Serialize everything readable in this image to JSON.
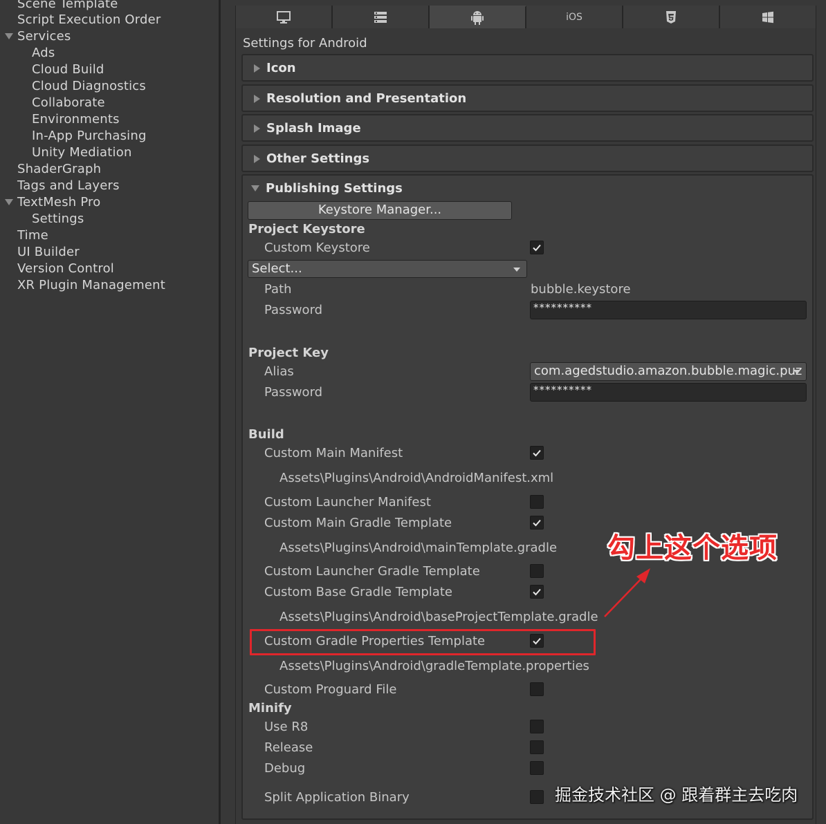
{
  "sidebar": {
    "items": [
      {
        "label": "Scene Template",
        "level": 1
      },
      {
        "label": "Script Execution Order",
        "level": 1
      },
      {
        "label": "Services",
        "level": 1,
        "expanded": true
      },
      {
        "label": "Ads",
        "level": 2
      },
      {
        "label": "Cloud Build",
        "level": 2
      },
      {
        "label": "Cloud Diagnostics",
        "level": 2
      },
      {
        "label": "Collaborate",
        "level": 2
      },
      {
        "label": "Environments",
        "level": 2
      },
      {
        "label": "In-App Purchasing",
        "level": 2
      },
      {
        "label": "Unity Mediation",
        "level": 2
      },
      {
        "label": "ShaderGraph",
        "level": 1
      },
      {
        "label": "Tags and Layers",
        "level": 1
      },
      {
        "label": "TextMesh Pro",
        "level": 1,
        "expanded": true
      },
      {
        "label": "Settings",
        "level": 2
      },
      {
        "label": "Time",
        "level": 1
      },
      {
        "label": "UI Builder",
        "level": 1
      },
      {
        "label": "Version Control",
        "level": 1
      },
      {
        "label": "XR Plugin Management",
        "level": 1
      }
    ]
  },
  "platform_tabs": [
    {
      "name": "standalone",
      "icon": "monitor-icon",
      "active": false
    },
    {
      "name": "server",
      "icon": "server-icon",
      "active": false
    },
    {
      "name": "android",
      "icon": "android-icon",
      "active": true
    },
    {
      "name": "ios",
      "label": "iOS",
      "active": false
    },
    {
      "name": "webgl",
      "icon": "html5-icon",
      "active": false
    },
    {
      "name": "windows",
      "icon": "windows-icon",
      "active": false
    }
  ],
  "settings_title": "Settings for Android",
  "foldouts": [
    {
      "label": "Icon"
    },
    {
      "label": "Resolution and Presentation"
    },
    {
      "label": "Splash Image"
    },
    {
      "label": "Other Settings"
    }
  ],
  "publishing": {
    "title": "Publishing Settings",
    "keystore_manager_button": "Keystore Manager...",
    "project_keystore": {
      "header": "Project Keystore",
      "custom_keystore_label": "Custom Keystore",
      "custom_keystore_checked": true,
      "select_value": "Select...",
      "path_label": "Path",
      "path_value": "bubble.keystore",
      "password_label": "Password",
      "password_value": "**********"
    },
    "project_key": {
      "header": "Project Key",
      "alias_label": "Alias",
      "alias_value": "com.agedstudio.amazon.bubble.magic.puz",
      "password_label": "Password",
      "password_value": "**********"
    },
    "build": {
      "header": "Build",
      "custom_main_manifest": {
        "label": "Custom Main Manifest",
        "checked": true,
        "path": "Assets\\Plugins\\Android\\AndroidManifest.xml"
      },
      "custom_launcher_manifest": {
        "label": "Custom Launcher Manifest",
        "checked": false
      },
      "custom_main_gradle_template": {
        "label": "Custom Main Gradle Template",
        "checked": true,
        "path": "Assets\\Plugins\\Android\\mainTemplate.gradle"
      },
      "custom_launcher_gradle_template": {
        "label": "Custom Launcher Gradle Template",
        "checked": false
      },
      "custom_base_gradle_template": {
        "label": "Custom Base Gradle Template",
        "checked": true,
        "path": "Assets\\Plugins\\Android\\baseProjectTemplate.gradle"
      },
      "custom_gradle_properties_template": {
        "label": "Custom Gradle Properties Template",
        "checked": true,
        "path": "Assets\\Plugins\\Android\\gradleTemplate.properties"
      },
      "custom_proguard_file": {
        "label": "Custom Proguard File",
        "checked": false
      }
    },
    "minify": {
      "header": "Minify",
      "use_r8": {
        "label": "Use R8",
        "checked": false
      },
      "release": {
        "label": "Release",
        "checked": false
      },
      "debug": {
        "label": "Debug",
        "checked": false
      }
    },
    "split_application_binary": {
      "label": "Split Application Binary",
      "checked": false
    }
  },
  "annotation": {
    "text": "勾上这个选项",
    "color": "#e0262b"
  },
  "watermark": "掘金技术社区 @ 跟着群主去吃肉"
}
